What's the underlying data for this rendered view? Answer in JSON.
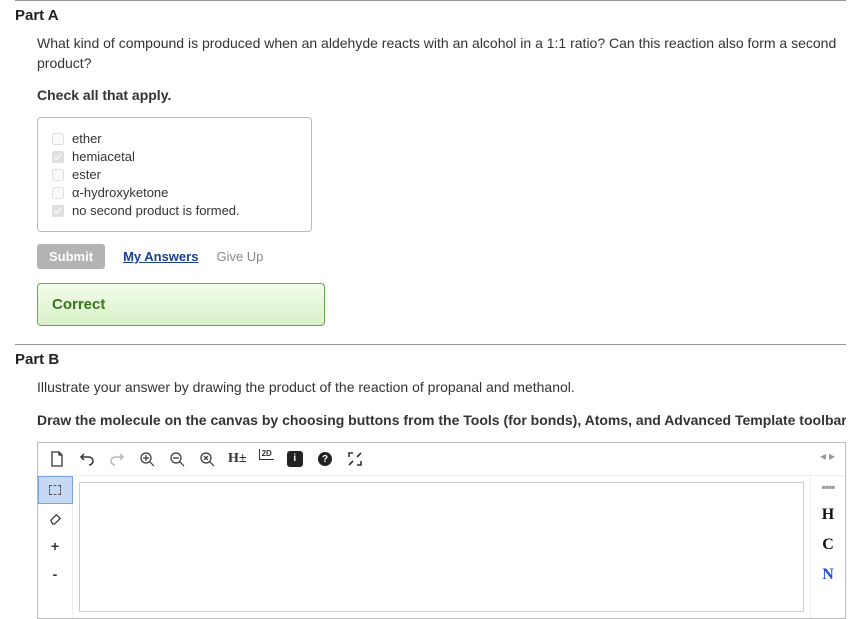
{
  "partA": {
    "label": "Part A",
    "question": "What kind of compound is produced when an aldehyde reacts with an alcohol in a 1:1 ratio? Can this reaction also form a second product?",
    "instruction": "Check all that apply.",
    "options": [
      {
        "label": "ether",
        "checked": false
      },
      {
        "label": "hemiacetal",
        "checked": true
      },
      {
        "label": "ester",
        "checked": false
      },
      {
        "label": "α-hydroxyketone",
        "checked": false
      },
      {
        "label": "no second product is formed.",
        "checked": true
      }
    ],
    "buttons": {
      "submit": "Submit",
      "myAnswers": "My Answers",
      "giveUp": "Give Up"
    },
    "feedback": "Correct"
  },
  "partB": {
    "label": "Part B",
    "question": "Illustrate your answer by drawing the product of the reaction of propanal and methanol.",
    "instruction": "Draw the molecule on the canvas by choosing buttons from the Tools (for bonds), Atoms, and Advanced Template toolbars. The singl",
    "toolbarTop": {
      "hLabel": "H±",
      "twoD": "2D"
    },
    "toolbarLeft": {
      "plus": "+",
      "minus": "-"
    },
    "toolbarRight": {
      "atoms": [
        "H",
        "C",
        "N"
      ]
    }
  }
}
